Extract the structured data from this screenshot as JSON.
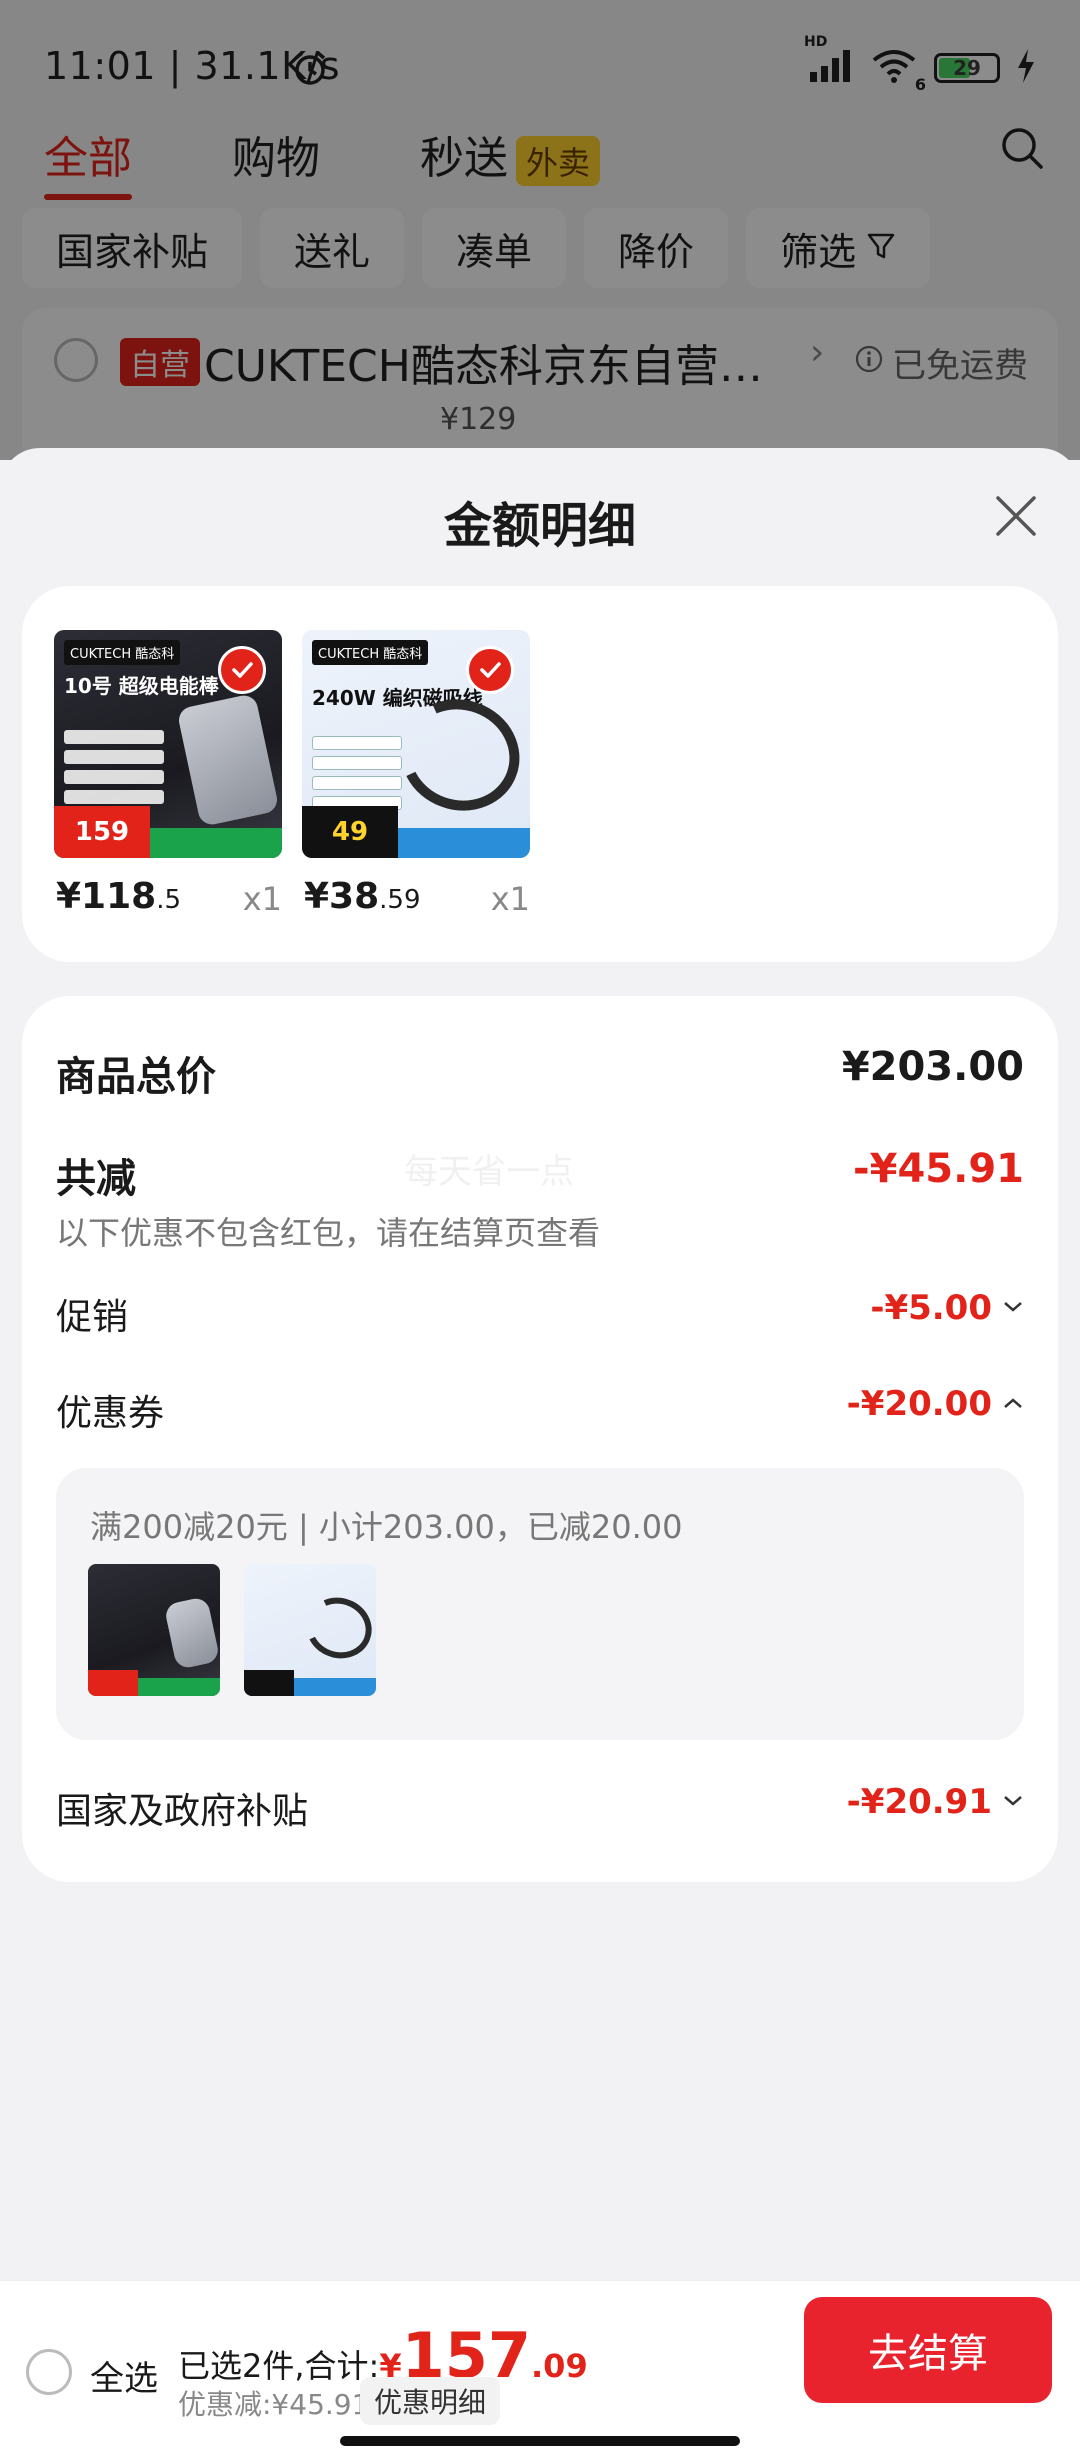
{
  "status_bar": {
    "time": "11:01 | 31.1K/s",
    "battery": "29",
    "signal_label": "HD",
    "wifi_label": "6"
  },
  "top_tabs": [
    {
      "label": "全部",
      "active": true
    },
    {
      "label": "购物",
      "active": false
    },
    {
      "label": "秒送",
      "active": false,
      "badge": "外卖"
    }
  ],
  "filters": [
    "国家补贴",
    "送礼",
    "凑单",
    "降价",
    "筛选"
  ],
  "store": {
    "badge": "自营",
    "name": "CUKTECH酷态科京东自营…",
    "shipping": "已免运费",
    "price": "¥129"
  },
  "sheet": {
    "title": "金额明细",
    "products": [
      {
        "price_int": "¥118",
        "price_dec": ".5",
        "qty": "x1",
        "brand": "CUKTECH 酷态科",
        "headline": "10号 超级电能棒",
        "tag_price": "159"
      },
      {
        "price_int": "¥38",
        "price_dec": ".59",
        "qty": "x1",
        "brand": "CUKTECH 酷态科",
        "headline": "240W 编织磁吸线",
        "tag_price": "49"
      }
    ],
    "total_label": "商品总价",
    "total_value": "¥203.00",
    "reduce_label": "共减",
    "reduce_value": "-¥45.91",
    "reduce_note": "以下优惠不包含红包，请在结算页查看",
    "watermark": "每天省一点",
    "promo_label": "促销",
    "promo_value": "-¥5.00",
    "coupon_label": "优惠券",
    "coupon_value": "-¥20.00",
    "coupon_detail": "满200减20元 | 小计203.00，已减20.00",
    "subsidy_label": "国家及政府补贴",
    "subsidy_value": "-¥20.91"
  },
  "bottom_bar": {
    "select_all": "全选",
    "summary_prefix": "已选2件,合计:",
    "currency": "¥",
    "total_int": "157",
    "total_dec": ".09",
    "discount": "优惠减:¥45.91",
    "detail_button": "优惠明细",
    "checkout_button": "去结算"
  },
  "colors": {
    "accent": "#e2231a",
    "checkout": "#e8232d",
    "background": "#f2f2f4"
  },
  "icons": [
    "alarm-icon",
    "signal-icon",
    "wifi-icon",
    "battery-icon",
    "charging-icon",
    "search-icon",
    "filter-icon",
    "info-icon",
    "close-icon",
    "check-icon",
    "chevron-down-icon",
    "chevron-up-icon"
  ]
}
